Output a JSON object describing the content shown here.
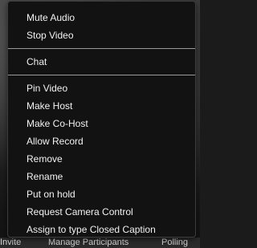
{
  "menu": {
    "groups": [
      [
        "Mute Audio",
        "Stop Video"
      ],
      [
        "Chat"
      ],
      [
        "Pin Video",
        "Make Host",
        "Make Co-Host",
        "Allow Record",
        "Remove",
        "Rename",
        "Put on hold",
        "Request Camera Control",
        "Assign to type Closed Caption"
      ]
    ]
  },
  "toolbar": {
    "invite_label": "Invite",
    "participants_label": "Manage Participants",
    "polling_label": "Polling"
  },
  "colors": {
    "menu_bg": "#121212",
    "menu_text": "#f2f2f2",
    "separator": "#9a9a9a"
  }
}
